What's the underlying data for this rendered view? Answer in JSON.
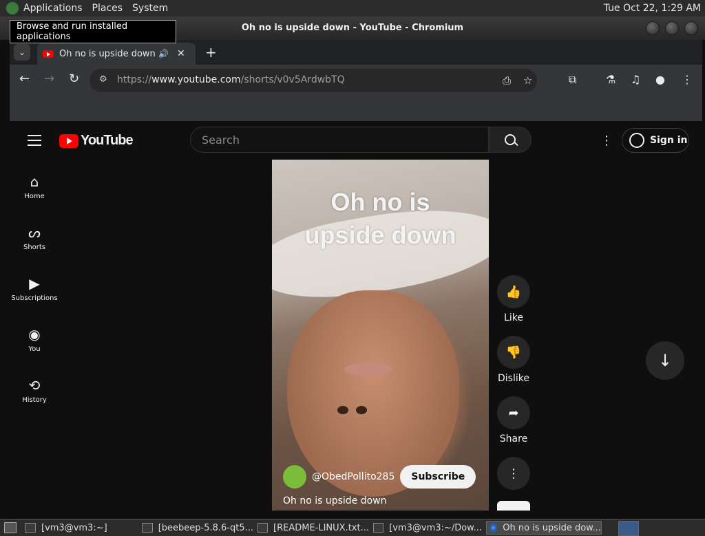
{
  "system_panel": {
    "menus": [
      "Applications",
      "Places",
      "System"
    ],
    "clock": "Tue Oct 22,  1:29 AM",
    "tooltip": "Browse and run installed applications"
  },
  "window": {
    "title": "Oh no is upside down - YouTube - Chromium"
  },
  "browser": {
    "tab_title": "Oh no is upside down - YouTube",
    "url_prefix": "https://",
    "url_domain": "www.youtube.com",
    "url_path": "/shorts/v0v5ArdwbTQ"
  },
  "youtube": {
    "logo_text": "YouTube",
    "search_placeholder": "Search",
    "sign_in": "Sign in",
    "sidebar": [
      {
        "label": "Home",
        "icon": "home-icon"
      },
      {
        "label": "Shorts",
        "icon": "shorts-icon"
      },
      {
        "label": "Subscriptions",
        "icon": "subscriptions-icon"
      },
      {
        "label": "You",
        "icon": "you-icon"
      },
      {
        "label": "History",
        "icon": "history-icon"
      }
    ],
    "short": {
      "caption_line1": "Oh no is",
      "caption_line2": "upside down",
      "channel": "@ObedPollito285",
      "subscribe": "Subscribe",
      "title": "Oh no is upside down"
    },
    "actions": {
      "like": "Like",
      "dislike": "Dislike",
      "share": "Share"
    }
  },
  "taskbar": {
    "items": [
      "[vm3@vm3:~]",
      "[beebeep-5.8.6-qt5...",
      "[README-LINUX.txt...",
      "[vm3@vm3:~/Dow...",
      "Oh no is upside dow..."
    ]
  },
  "colors": {
    "yt_red": "#ff0000",
    "page_bg": "#0f0f0f",
    "chrome_toolbar": "#35363a"
  }
}
